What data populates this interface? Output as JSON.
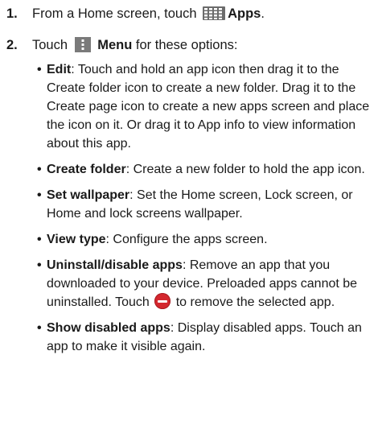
{
  "steps": [
    {
      "number": "1.",
      "before": "From a Home screen, touch",
      "icon": "apps-grid-icon",
      "bold": "Apps",
      "after": "."
    },
    {
      "number": "2.",
      "before": "Touch",
      "icon": "menu-dots-icon",
      "bold": "Menu",
      "after": " for these options:"
    }
  ],
  "options": [
    {
      "term": "Edit",
      "text": ": Touch and hold an app icon then drag it to the Create folder icon to create a new folder. Drag it to the Create page icon to create a new apps screen and place the icon on it. Or drag it to App info to view information about this app."
    },
    {
      "term": "Create folder",
      "text": ": Create a new folder to hold the app icon."
    },
    {
      "term": "Set wallpaper",
      "text": ": Set the Home screen, Lock screen, or Home and lock screens wallpaper."
    },
    {
      "term": "View type",
      "text": ": Configure the apps screen."
    },
    {
      "term": "Uninstall/disable apps",
      "text": ": Remove an app that you downloaded to your device. Preloaded apps cannot be uninstalled. Touch",
      "icon": "remove-circle-icon",
      "text_after": " to remove the selected app."
    },
    {
      "term": "Show disabled apps",
      "text": ": Display disabled apps. Touch an app to make it visible again."
    }
  ],
  "colors": {
    "icon_gray": "#6b6b6b",
    "remove_red": "#d4272e"
  }
}
